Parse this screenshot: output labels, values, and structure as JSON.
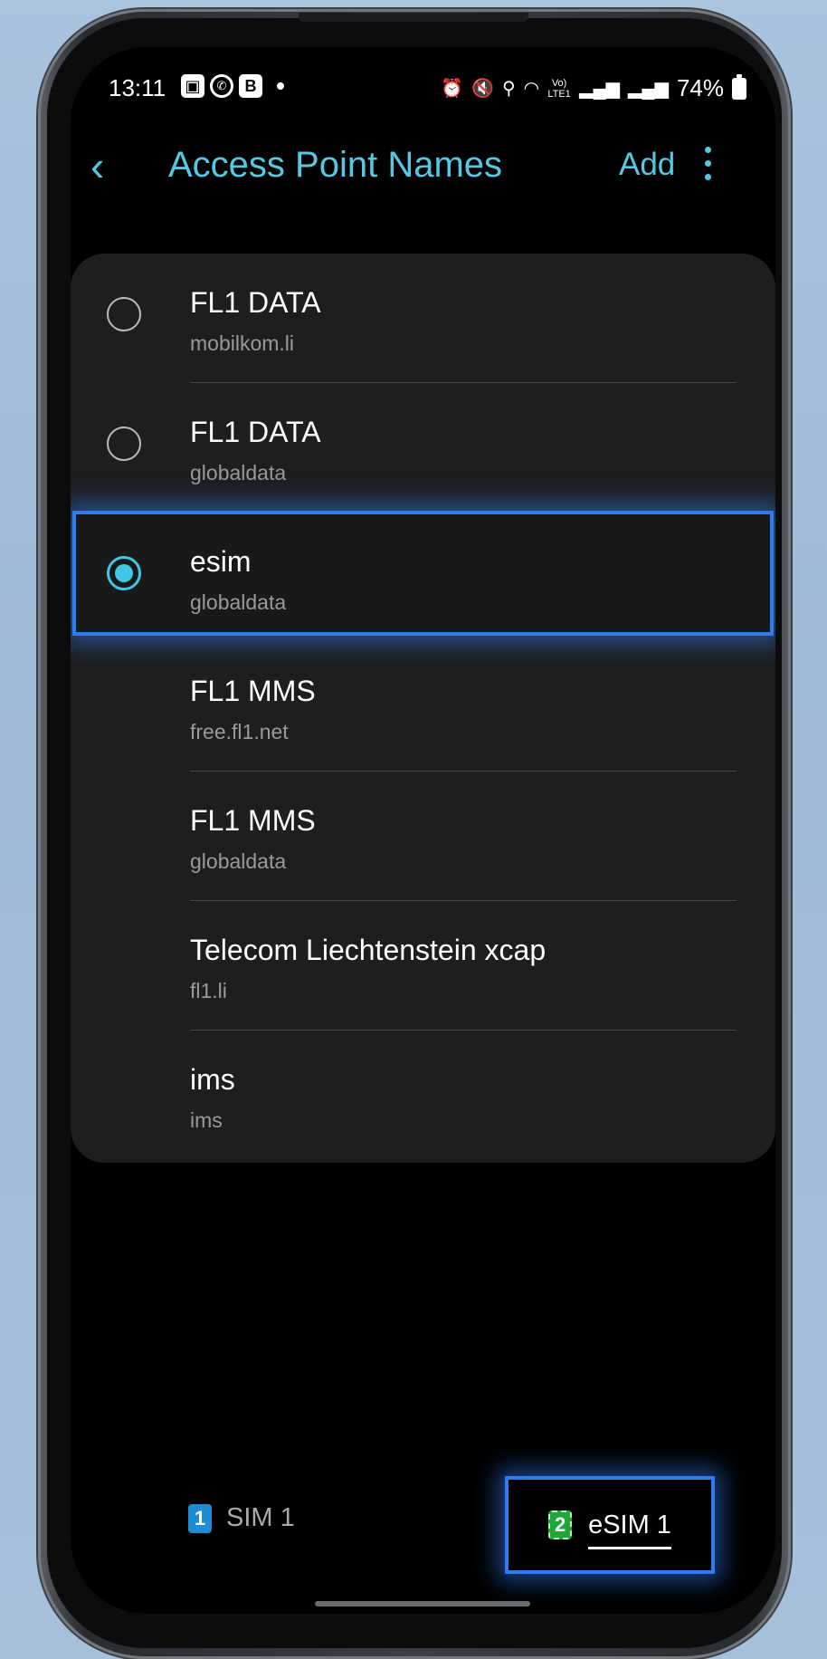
{
  "status_bar": {
    "time": "13:11",
    "left_icons": [
      "gallery-icon",
      "whatsapp-icon",
      "b-app-icon"
    ],
    "notification_dot": "•",
    "right_icons": [
      "alarm-icon",
      "mute-icon",
      "location-icon",
      "wifi-icon",
      "volte-icon",
      "signal-icon",
      "signal-icon"
    ],
    "volte_label": "Vo) LTE1",
    "battery": "74%"
  },
  "header": {
    "title": "Access Point Names",
    "add_label": "Add",
    "back_icon": "chevron-left-icon",
    "more_icon": "more-vertical-icon",
    "accent_color": "#55c8e4"
  },
  "apn_list": {
    "items": [
      {
        "name": "FL1 DATA",
        "apn": "mobilkom.li",
        "has_radio": true,
        "selected": false
      },
      {
        "name": "FL1 DATA",
        "apn": "globaldata",
        "has_radio": true,
        "selected": false
      },
      {
        "name": "esim",
        "apn": "globaldata",
        "has_radio": true,
        "selected": true
      },
      {
        "name": "FL1 MMS",
        "apn": "free.fl1.net",
        "has_radio": false,
        "selected": false
      },
      {
        "name": "FL1 MMS",
        "apn": "globaldata",
        "has_radio": false,
        "selected": false
      },
      {
        "name": "Telecom Liechtenstein xcap",
        "apn": "fl1.li",
        "has_radio": false,
        "selected": false
      },
      {
        "name": "ims",
        "apn": "ims",
        "has_radio": false,
        "selected": false
      }
    ],
    "highlight_color": "#2f7bf2"
  },
  "sim_tabs": {
    "sim1": {
      "number": "1",
      "label": "SIM 1",
      "selected": false
    },
    "esim1": {
      "number": "2",
      "label": "eSIM 1",
      "selected": true
    }
  }
}
